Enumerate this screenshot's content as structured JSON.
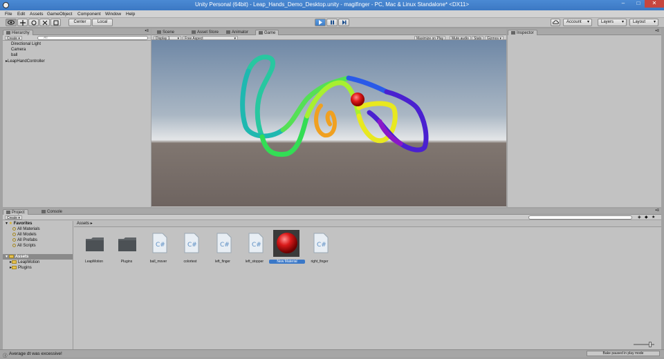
{
  "window": {
    "title": "Unity Personal (64bit) - Leap_Hands_Demo_Desktop.unity - magifinger - PC, Mac & Linux Standalone* <DX11>",
    "minimize": "–",
    "maximize": "□",
    "close": "✕"
  },
  "menu": [
    "File",
    "Edit",
    "Assets",
    "GameObject",
    "Component",
    "Window",
    "Help"
  ],
  "toolbar": {
    "pivot": "Center",
    "space": "Local",
    "account": "Account",
    "layers": "Layers",
    "layout": "Layout"
  },
  "hierarchy": {
    "tab": "Hierarchy",
    "create": "Create",
    "search_placeholder": "All",
    "items": [
      "Directional Light",
      "Camera",
      "ball",
      "LeapHandController"
    ]
  },
  "center_tabs": [
    "Scene",
    "Asset Store",
    "Animator",
    "Game"
  ],
  "game": {
    "display": "Display 1",
    "aspect": "Free Aspect",
    "options": [
      "Maximize on Play",
      "Mute audio",
      "Stats",
      "Gizmos"
    ]
  },
  "inspector": {
    "tab": "Inspector"
  },
  "project": {
    "tabs": [
      "Project",
      "Console"
    ],
    "create": "Create",
    "favorites_label": "Favorites",
    "favorites": [
      "All Materials",
      "All Models",
      "All Prefabs",
      "All Scripts"
    ],
    "assets_root": "Assets",
    "asset_folders": [
      "LeapMotion",
      "Plugins"
    ],
    "breadcrumb": "Assets",
    "assets": [
      {
        "name": "LeapMotion",
        "kind": "folder"
      },
      {
        "name": "Plugins",
        "kind": "folder"
      },
      {
        "name": "ball_mover",
        "kind": "script"
      },
      {
        "name": "colortest",
        "kind": "script"
      },
      {
        "name": "left_finger",
        "kind": "script"
      },
      {
        "name": "left_stopper",
        "kind": "script"
      },
      {
        "name": "New Material",
        "kind": "material"
      },
      {
        "name": "right_finger",
        "kind": "script"
      }
    ],
    "script_icon_text": "C#"
  },
  "status": {
    "message": "Average dt was excessive!",
    "bake": "Bake paused in play mode"
  },
  "colors": {
    "titlebar": "#3b78c3",
    "play_active": "#3f7fc8",
    "material_red": "#d91a1a"
  }
}
